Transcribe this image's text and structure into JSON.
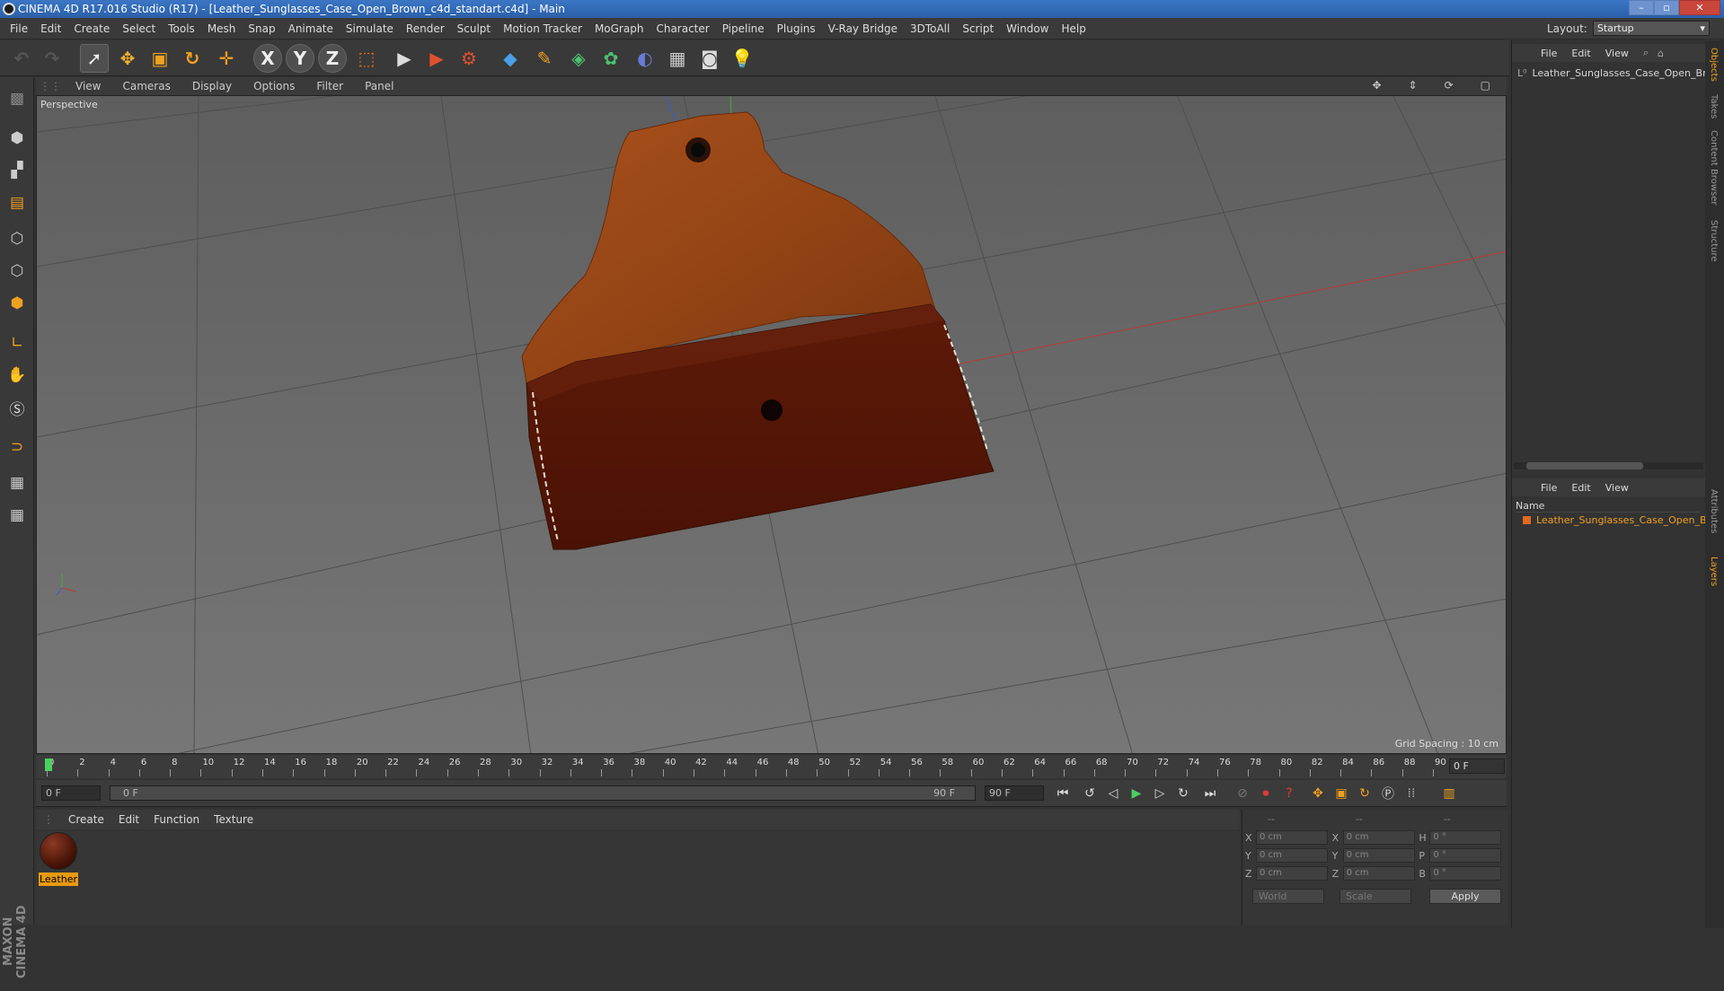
{
  "window": {
    "title": "CINEMA 4D R17.016 Studio (R17) - [Leather_Sunglasses_Case_Open_Brown_c4d_standart.c4d] - Main",
    "min": "–",
    "max": "▫",
    "close": "✕"
  },
  "menu": [
    "File",
    "Edit",
    "Create",
    "Select",
    "Tools",
    "Mesh",
    "Snap",
    "Animate",
    "Simulate",
    "Render",
    "Sculpt",
    "Motion Tracker",
    "MoGraph",
    "Character",
    "Pipeline",
    "Plugins",
    "V-Ray Bridge",
    "3DToAll",
    "Script",
    "Window",
    "Help"
  ],
  "layout": {
    "label": "Layout:",
    "value": "Startup"
  },
  "toolbar": {
    "x": "X",
    "y": "Y",
    "z": "Z"
  },
  "viewport": {
    "menu": [
      "View",
      "Cameras",
      "Display",
      "Options",
      "Filter",
      "Panel"
    ],
    "label": "Perspective",
    "grid_spacing": "Grid Spacing : 10 cm"
  },
  "timeline": {
    "ticks": [
      "0",
      "2",
      "4",
      "6",
      "8",
      "10",
      "12",
      "14",
      "16",
      "18",
      "20",
      "22",
      "24",
      "26",
      "28",
      "30",
      "32",
      "34",
      "36",
      "38",
      "40",
      "42",
      "44",
      "46",
      "48",
      "50",
      "52",
      "54",
      "56",
      "58",
      "60",
      "62",
      "64",
      "66",
      "68",
      "70",
      "72",
      "74",
      "76",
      "78",
      "80",
      "82",
      "84",
      "86",
      "88",
      "90"
    ],
    "current": "0 F",
    "start": "0 F",
    "range_start": "0 F",
    "range_end": "90 F",
    "end": "90 F"
  },
  "material_panel": {
    "menu": [
      "Create",
      "Edit",
      "Function",
      "Texture"
    ],
    "materials": [
      {
        "name": "Leather"
      }
    ]
  },
  "coords": {
    "header": [
      "--",
      "--",
      "--"
    ],
    "rows": [
      {
        "a": "X",
        "av": "0 cm",
        "b": "X",
        "bv": "0 cm",
        "c": "H",
        "cv": "0 °"
      },
      {
        "a": "Y",
        "av": "0 cm",
        "b": "Y",
        "bv": "0 cm",
        "c": "P",
        "cv": "0 °"
      },
      {
        "a": "Z",
        "av": "0 cm",
        "b": "Z",
        "bv": "0 cm",
        "c": "B",
        "cv": "0 °"
      }
    ],
    "mode1": "World",
    "mode2": "Scale",
    "apply": "Apply"
  },
  "objects_panel": {
    "menu": [
      "File",
      "Edit",
      "View"
    ],
    "item": "Leather_Sunglasses_Case_Open_Br"
  },
  "layers_panel": {
    "menu": [
      "File",
      "Edit",
      "View"
    ],
    "column": "Name",
    "item": "Leather_Sunglasses_Case_Open_B"
  },
  "side_tabs": [
    "Objects",
    "Takes",
    "Content Browser",
    "Structure",
    "Attributes",
    "Layers"
  ],
  "brand": "MAXON CINEMA 4D"
}
